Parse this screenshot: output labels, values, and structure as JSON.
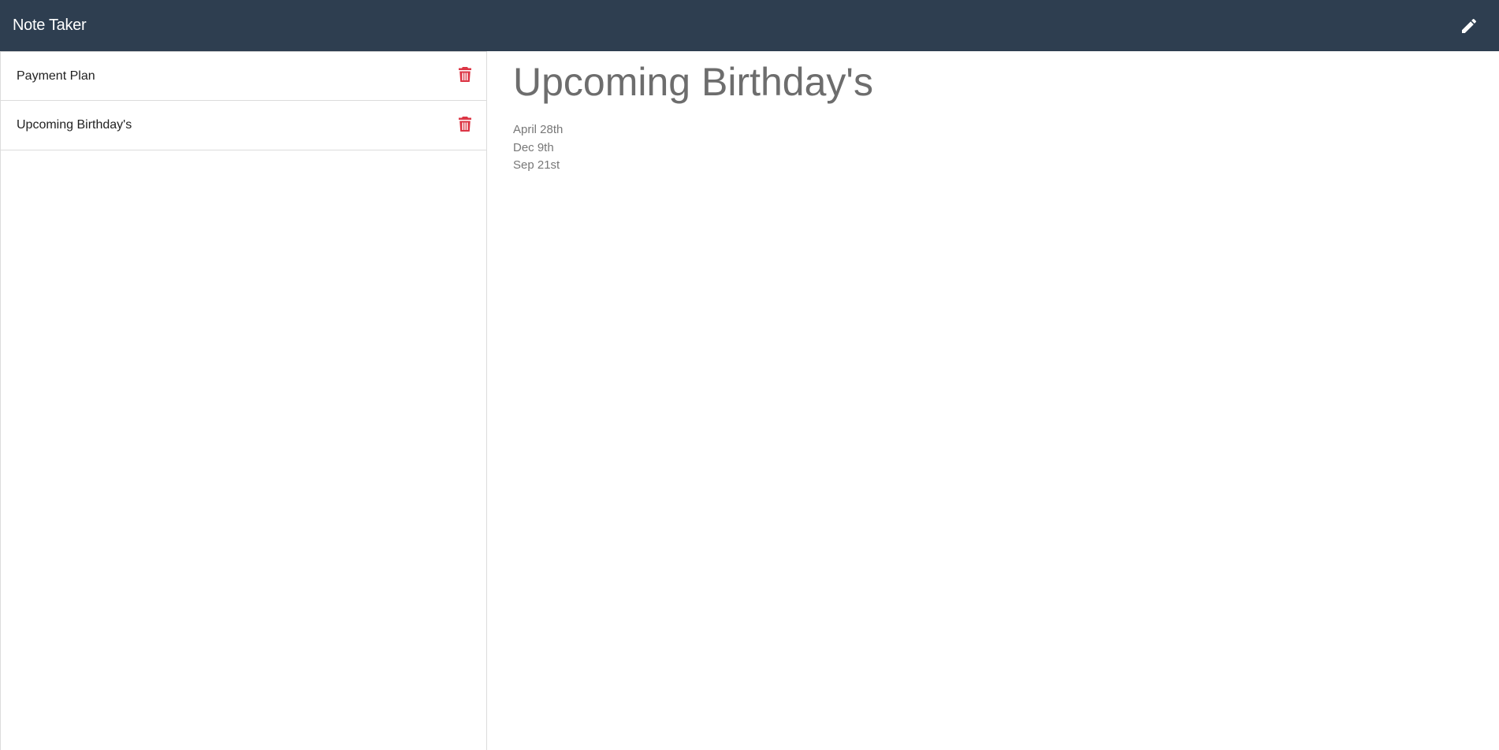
{
  "app": {
    "title": "Note Taker",
    "accent_color": "#2e3e50",
    "delete_color": "#dc3545"
  },
  "header": {
    "new_note_icon": "pencil-icon"
  },
  "sidebar": {
    "notes": [
      {
        "title": "Payment Plan",
        "delete_icon": "trash-icon"
      },
      {
        "title": "Upcoming Birthday's",
        "delete_icon": "trash-icon"
      }
    ]
  },
  "main": {
    "note_title": "Upcoming Birthday's",
    "note_lines": [
      "April 28th",
      "Dec 9th",
      "Sep 21st"
    ]
  }
}
